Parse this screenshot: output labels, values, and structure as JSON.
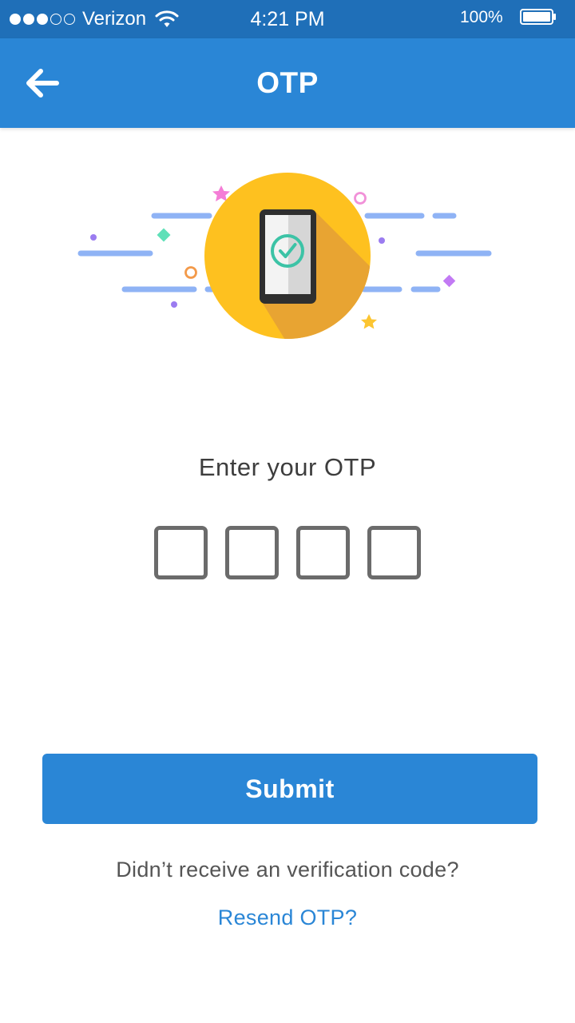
{
  "status_bar": {
    "carrier": "Verizon",
    "time": "4:21 PM",
    "battery_percent": "100%",
    "signal_bars_filled": 3,
    "signal_bars_total": 5,
    "battery_level": 1.0
  },
  "header": {
    "title": "OTP",
    "back_icon": "arrow-left-icon"
  },
  "illustration": {
    "icon": "phone-verified-icon",
    "colors": {
      "circle": "#fec11f",
      "shadow": "#e8a432",
      "check": "#3cc3a6",
      "lines": "#8fb3f5"
    }
  },
  "otp": {
    "prompt": "Enter your OTP",
    "digits": [
      "",
      "",
      "",
      ""
    ]
  },
  "actions": {
    "submit_label": "Submit",
    "hint": "Didn’t receive an verification code?",
    "resend_label": "Resend OTP?"
  },
  "colors": {
    "primary": "#2a86d6",
    "status_bar": "#1f6fb8",
    "text": "#3d3d3d",
    "box_border": "#6b6b6b"
  }
}
